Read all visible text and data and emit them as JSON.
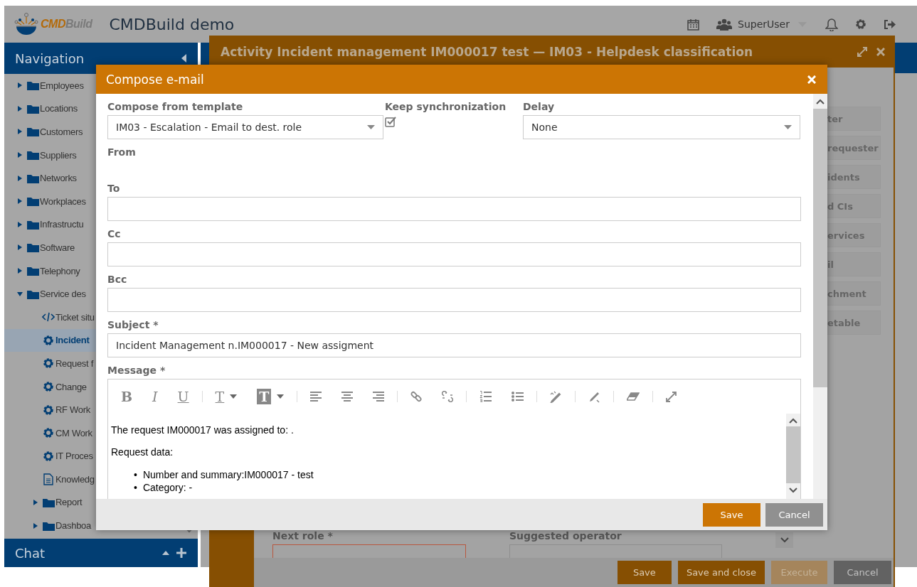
{
  "header": {
    "logo_parts": [
      "CMD",
      "Build"
    ],
    "app_title": "CMDBuild demo",
    "user": "SuperUser"
  },
  "navigation": {
    "title": "Navigation",
    "items": [
      {
        "label": "Employees",
        "kind": "folder",
        "expanded": false,
        "selected": false
      },
      {
        "label": "Locations",
        "kind": "folder",
        "expanded": false,
        "selected": false
      },
      {
        "label": "Customers",
        "kind": "folder",
        "expanded": false,
        "selected": false
      },
      {
        "label": "Suppliers",
        "kind": "folder",
        "expanded": false,
        "selected": false
      },
      {
        "label": "Networks",
        "kind": "folder",
        "expanded": false,
        "selected": false
      },
      {
        "label": "Workplaces",
        "kind": "folder",
        "expanded": false,
        "selected": false
      },
      {
        "label": "Infrastructu",
        "kind": "folder",
        "expanded": false,
        "selected": false
      },
      {
        "label": "Software",
        "kind": "folder",
        "expanded": false,
        "selected": false
      },
      {
        "label": "Telephony",
        "kind": "folder",
        "expanded": false,
        "selected": false
      },
      {
        "label": "Service des",
        "kind": "folder",
        "expanded": true,
        "selected": false,
        "children": [
          {
            "label": "Ticket situ",
            "kind": "script",
            "selected": false
          },
          {
            "label": "Incident",
            "kind": "process",
            "selected": true
          },
          {
            "label": "Request f",
            "kind": "process",
            "selected": false
          },
          {
            "label": "Change",
            "kind": "process",
            "selected": false
          },
          {
            "label": "RF Work",
            "kind": "process",
            "selected": false
          },
          {
            "label": "CM Work",
            "kind": "process",
            "selected": false
          },
          {
            "label": "IT Proces",
            "kind": "process",
            "selected": false
          },
          {
            "label": "Knowledg",
            "kind": "document",
            "selected": false
          },
          {
            "label": "Report",
            "kind": "folder",
            "expanded": false,
            "selected": false
          },
          {
            "label": "Dashboa",
            "kind": "folder",
            "expanded": false,
            "selected": false
          }
        ]
      }
    ],
    "chat_title": "Chat"
  },
  "activity": {
    "title": "Activity Incident management IM000017 test — IM03 - Helpdesk classification",
    "side_tabs": [
      "ter",
      "requester",
      "idents",
      "d CIs",
      "ervices",
      "il",
      "chment",
      "etable"
    ],
    "fields": [
      {
        "label": "Next role *",
        "invalid": true
      },
      {
        "label": "Suggested operator",
        "invalid": false
      }
    ],
    "buttons": [
      {
        "label": "Save",
        "kind": "primary",
        "disabled": false
      },
      {
        "label": "Save and close",
        "kind": "primary",
        "disabled": false
      },
      {
        "label": "Execute",
        "kind": "primary",
        "disabled": true
      },
      {
        "label": "Cancel",
        "kind": "secondary",
        "disabled": false
      }
    ]
  },
  "dialog": {
    "title": "Compose e-mail",
    "template": {
      "label": "Compose from template",
      "value": "IM03 - Escalation - Email to dest. role"
    },
    "keep_sync": {
      "label": "Keep synchronization",
      "checked": true
    },
    "delay": {
      "label": "Delay",
      "value": "None"
    },
    "from": {
      "label": "From"
    },
    "recipients": [
      {
        "label": "To"
      },
      {
        "label": "Cc"
      },
      {
        "label": "Bcc"
      }
    ],
    "subject": {
      "label": "Subject *",
      "value": "Incident Management n.IM000017 - New assigment"
    },
    "message": {
      "label": "Message *",
      "toolbar": [
        [
          {
            "kind": "bold",
            "glyph": "B"
          },
          {
            "kind": "italic",
            "glyph": "I"
          },
          {
            "kind": "underline",
            "glyph": "U"
          }
        ],
        [
          {
            "kind": "text-color",
            "glyph": "T"
          },
          {
            "kind": "background-color",
            "glyph": "T"
          }
        ],
        [
          {
            "kind": "align-left"
          },
          {
            "kind": "align-center"
          },
          {
            "kind": "align-right"
          }
        ],
        [
          {
            "kind": "link"
          },
          {
            "kind": "unlink"
          }
        ],
        [
          {
            "kind": "numbered-list"
          },
          {
            "kind": "bulleted-list"
          }
        ],
        [
          {
            "kind": "source"
          }
        ],
        [
          {
            "kind": "pencil"
          }
        ],
        [
          {
            "kind": "eraser"
          }
        ],
        [
          {
            "kind": "maximize"
          }
        ]
      ],
      "paragraphs": [
        "The request IM000017 was assigned to: .",
        "Request data:"
      ],
      "bullets": [
        {
          "marker": "•",
          "text": "Number and summary:IM000017 - test"
        },
        {
          "marker": "•",
          "text": "Category: -"
        }
      ]
    },
    "buttons": [
      {
        "label": "Save",
        "kind": "primary"
      },
      {
        "label": "Cancel",
        "kind": "secondary"
      }
    ]
  }
}
